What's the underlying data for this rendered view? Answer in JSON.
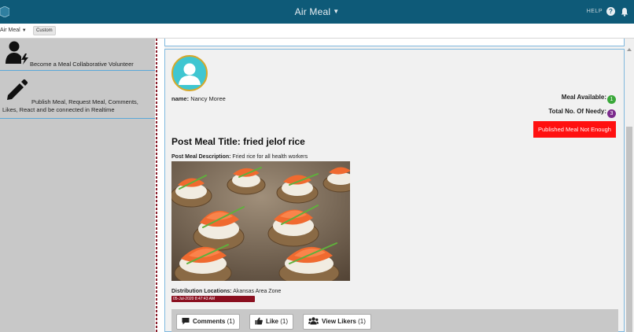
{
  "app": {
    "title": "Air Meal",
    "help_label": "HELP",
    "subbar_app": "Air Meal",
    "subbar_custom": "Custom"
  },
  "sidebar": {
    "items": [
      {
        "label": "Become a Meal Collaborative Volunteer",
        "icon": "user-bolt-icon"
      },
      {
        "label": "Publish Meal, Request Meal, Comments, Likes, React and be connected in Realtime",
        "icon": "pencil-icon"
      }
    ]
  },
  "post": {
    "name_label": "name:",
    "name_value": "Nancy Moree",
    "meal_available_label": "Meal Available:",
    "meal_available_count": "1",
    "needy_label": "Total No. Of Needy:",
    "needy_count": "3",
    "status_badge": "Published Meal Not Enough",
    "title": "Post Meal Title: fried jelof rice",
    "desc_label": "Post Meal Description:",
    "desc_value": "Fried rice for all health workers",
    "dist_label": "Distribution Locations:",
    "dist_value": "Akansas Area Zone",
    "date": "05-Jul-2020 8:47:43 AM",
    "actions": {
      "comments_label": "Comments",
      "comments_count": "(1)",
      "like_label": "Like",
      "like_count": "(1)",
      "view_likers_label": "View Likers",
      "view_likers_count": "(1)"
    }
  },
  "colors": {
    "topbar": "#0e5a78",
    "alert": "#ff1010",
    "date_badge": "#8b1020",
    "meal_dot": "#3aa83a",
    "needy_dot": "#7b2a8c"
  }
}
